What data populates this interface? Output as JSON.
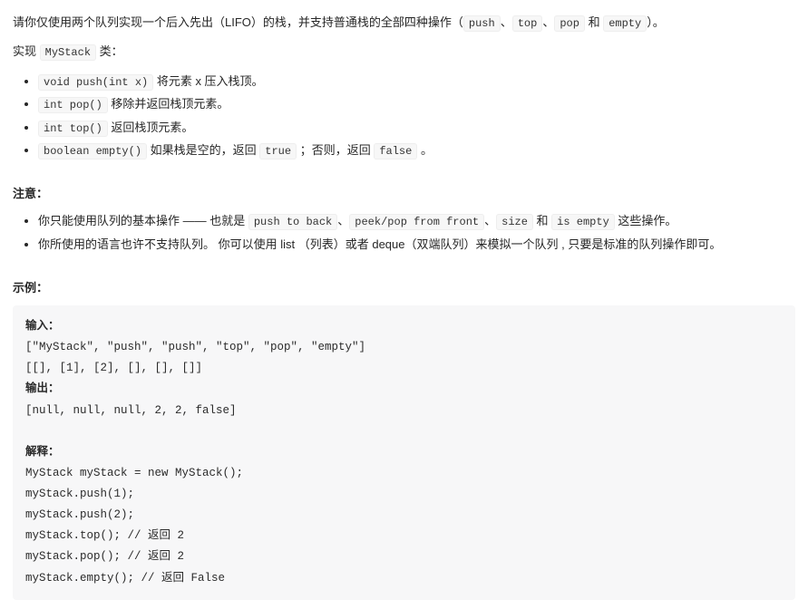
{
  "intro": {
    "l1_a": "请你仅使用两个队列实现一个后入先出（LIFO）的栈，并支持普通栈的全部四种操作（",
    "c1": "push",
    "sep1": "、",
    "c2": "top",
    "sep2": "、",
    "c3": "pop",
    "sep3": " 和 ",
    "c4": "empty",
    "l1_b": "）。",
    "l2_a": "实现 ",
    "c5": "MyStack",
    "l2_b": " 类："
  },
  "methods": [
    {
      "sig": "void push(int x)",
      "desc": " 将元素 x 压入栈顶。"
    },
    {
      "sig": "int pop()",
      "desc": " 移除并返回栈顶元素。"
    },
    {
      "sig": "int top()",
      "desc": " 返回栈顶元素。"
    },
    {
      "sig": "boolean empty()",
      "desc_a": " 如果栈是空的，返回 ",
      "c1": "true",
      "desc_b": " ；否则，返回 ",
      "c2": "false",
      "desc_c": " 。"
    }
  ],
  "note": {
    "title": "注意：",
    "li1_a": "你只能使用队列的基本操作 —— 也就是 ",
    "c1": "push to back",
    "s1": "、",
    "c2": "peek/pop from front",
    "s2": "、",
    "c3": "size",
    "s3": " 和 ",
    "c4": "is empty",
    "li1_b": " 这些操作。",
    "li2": "你所使用的语言也许不支持队列。 你可以使用 list （列表）或者 deque（双端队列）来模拟一个队列 , 只要是标准的队列操作即可。"
  },
  "example": {
    "title": "示例：",
    "in_label": "输入：",
    "in1": "[\"MyStack\", \"push\", \"push\", \"top\", \"pop\", \"empty\"]",
    "in2": "[[], [1], [2], [], [], []]",
    "out_label": "输出：",
    "out1": "[null, null, null, 2, 2, false]",
    "exp_label": "解释：",
    "e1": "MyStack myStack = new MyStack();",
    "e2": "myStack.push(1);",
    "e3": "myStack.push(2);",
    "e4": "myStack.top(); // 返回 2",
    "e5": "myStack.pop(); // 返回 2",
    "e6": "myStack.empty(); // 返回 False"
  }
}
